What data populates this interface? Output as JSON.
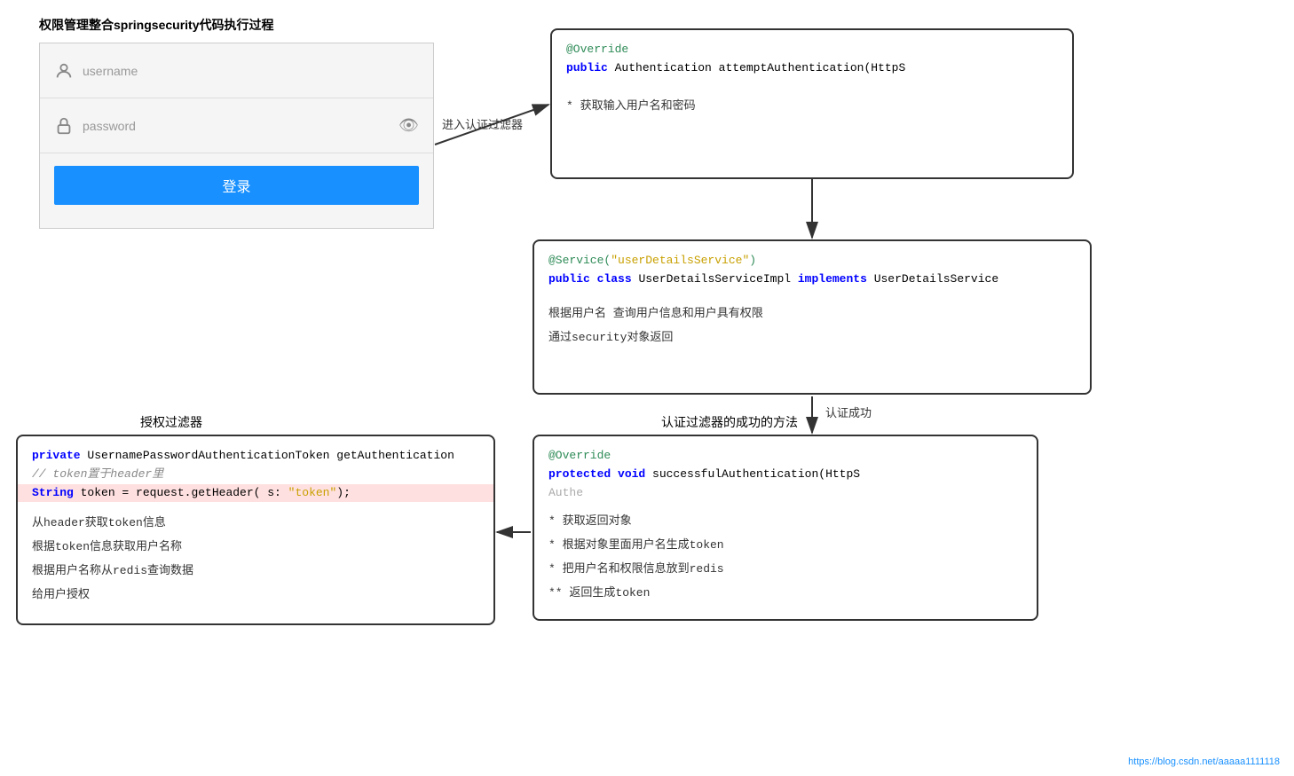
{
  "page": {
    "title": "权限管理整合springsecurity代码执行过程",
    "watermark": "https://blog.csdn.net/aaaaa1111118"
  },
  "login": {
    "username_placeholder": "username",
    "password_placeholder": "password",
    "login_btn": "登录"
  },
  "labels": {
    "enter_filter": "进入认证过滤器",
    "auth_success": "认证成功",
    "auth_filter_success": "认证过滤器的成功的方法",
    "auth_filter": "授权过滤器"
  },
  "code_top": {
    "line1": "@Override",
    "line2_k1": "public",
    "line2_k2": "Authentication",
    "line2_rest": " attemptAuthentication(HttpS",
    "note": "* 获取输入用户名和密码"
  },
  "code_middle": {
    "line1": "@Service(\"userDetailsService\")",
    "line2_k1": "public",
    "line2_k2": "class",
    "line2_rest": " UserDetailsServiceImpl ",
    "line2_k3": "implements",
    "line2_k4": "UserDetailsService",
    "note1": "根据用户名 查询用户信息和用户具有权限",
    "note2": "通过security对象返回"
  },
  "code_bottom_right": {
    "label": "认证过滤器的成功的方法",
    "line1": "@Override",
    "line2_k1": "protected",
    "line2_k2": "void",
    "line2_rest": " successfulAuthentication(HttpS",
    "line3": "                                Authe",
    "note1": "* 获取返回对象",
    "note2": "* 根据对象里面用户名生成token",
    "note3": "* 把用户名和权限信息放到redis",
    "note4": "** 返回生成token"
  },
  "code_bottom_left": {
    "label": "授权过滤器",
    "line1_k1": "private",
    "line1_rest": " UsernamePasswordAuthenticationToken getAuthentication",
    "line2": "    // token置于header里",
    "line3_k1": "    String",
    "line3_rest": " token = request.getHeader( s: \"token\");",
    "note1": "从header获取token信息",
    "note2": "根据token信息获取用户名称",
    "note3": "根据用户名称从redis查询数据",
    "note4": "给用户授权"
  }
}
